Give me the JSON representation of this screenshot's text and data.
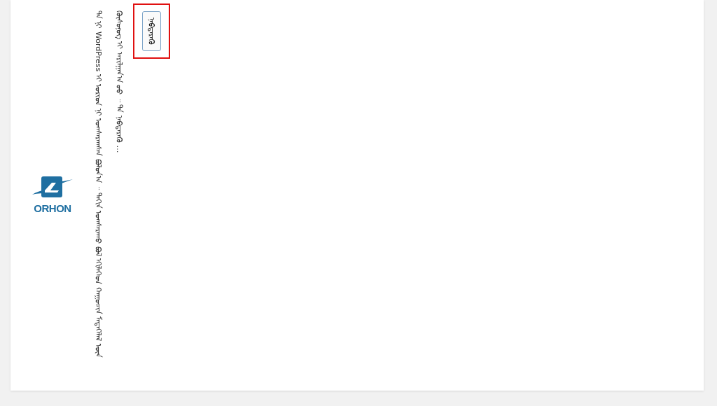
{
  "logo": {
    "text": "ORHON"
  },
  "message": "ᠲᠠ ᠨᠢ WordPress ᠢ ᠤᠷᠢᠳ ᠨᠢ ᠤᠭᠰᠠᠷᠠᠭᠰᠠᠨ ᠪᠣᠯᠣᠨ᠎ᠠ ᠃ ᠳᠠᠬᠢᠨ ᠤᠭᠰᠠᠷᠠᠬᠤ ᠪᠣᠯ ᠡᠬᠢᠯᠡᠭᠡᠳ ᠬᠠᠭᠤᠴᠢᠨ ᠮᠡᠳᠡᠭᠡᠯᠡᠯ ᠦᠨ ᠬᠦᠰᠦᠨᠦᠭ ᠢ ᠠᠷᠢᠯᠭᠠᠨ᠎ᠠ ᠤᠤ ᠃ ᠲᠠ ᠨᠡᠪᠲᠡᠷᠡᠬᠦ …",
  "button": {
    "label": "ᠨᠡᠪᠲᠡᠷᠡᠬᠦ",
    "highlighted": true
  }
}
